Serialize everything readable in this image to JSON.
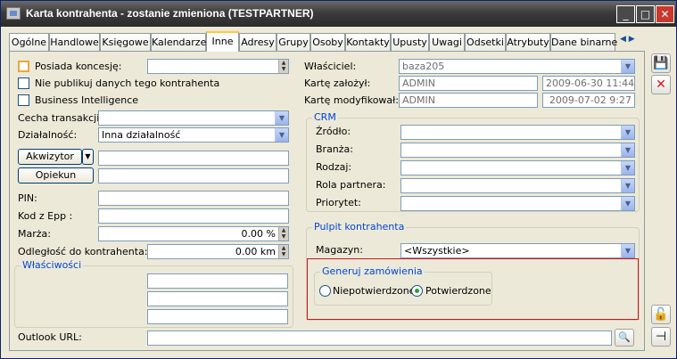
{
  "window": {
    "title": "Karta kontrahenta - zostanie zmieniona (TESTPARTNER)",
    "controls": {
      "minimize": "_",
      "maximize": "□",
      "close": "✕"
    }
  },
  "tabs": [
    "Ogólne",
    "Handlowe",
    "Księgowe",
    "Kalendarze",
    "Inne",
    "Adresy",
    "Grupy",
    "Osoby",
    "Kontakty",
    "Upusty",
    "Uwagi",
    "Odsetki",
    "Atrybuty",
    "Dane binarne"
  ],
  "active_tab": "Inne",
  "left": {
    "posiada_koncesje": {
      "label": "Posiada koncesję:",
      "checked": false,
      "value": ""
    },
    "nie_publikuj": {
      "label": "Nie publikuj danych tego kontrahenta",
      "checked": false
    },
    "business_intelligence": {
      "label": "Business Intelligence",
      "checked": false
    },
    "cecha_transakcji": {
      "label": "Cecha transakcji:",
      "value": ""
    },
    "dzialalnosc": {
      "label": "Działalność:",
      "value": "Inna działalność"
    },
    "akwizytor": {
      "label": "Akwizytor",
      "value": ""
    },
    "opiekun": {
      "label": "Opiekun",
      "value": ""
    },
    "pin": {
      "label": "PIN:",
      "value": ""
    },
    "kod_epp": {
      "label": "Kod z Epp :",
      "value": ""
    },
    "marza": {
      "label": "Marża:",
      "value": "0.00 %"
    },
    "odleglosc": {
      "label": "Odległość do kontrahenta:",
      "value": "0.00 km"
    },
    "wlasciwosci": {
      "title": "Właściwości"
    }
  },
  "right": {
    "wlasciciel": {
      "label": "Właściciel:",
      "value": "baza205"
    },
    "karte_zalozyl": {
      "label": "Kartę założył:",
      "user": "ADMIN",
      "date": "2009-06-30 11:44"
    },
    "karte_modyfikowal": {
      "label": "Kartę modyfikował:",
      "user": "ADMIN",
      "date": "2009-07-02  9:27"
    },
    "crm": {
      "title": "CRM",
      "fields": [
        {
          "label": "Źródło:",
          "value": ""
        },
        {
          "label": "Branża:",
          "value": ""
        },
        {
          "label": "Rodzaj:",
          "value": ""
        },
        {
          "label": "Rola partnera:",
          "value": ""
        },
        {
          "label": "Priorytet:",
          "value": ""
        }
      ]
    },
    "pulpit": {
      "title": "Pulpit kontrahenta",
      "magazyn": {
        "label": "Magazyn:",
        "value": "<Wszystkie>"
      },
      "generuj": {
        "title": "Generuj zamówienia",
        "options": [
          "Niepotwierdzone",
          "Potwierdzone"
        ],
        "selected": "Potwierdzone"
      }
    }
  },
  "outlook_url": {
    "label": "Outlook URL:",
    "value": ""
  },
  "colors": {
    "accent_red": "#d3121c",
    "group_title": "#0046d5"
  }
}
